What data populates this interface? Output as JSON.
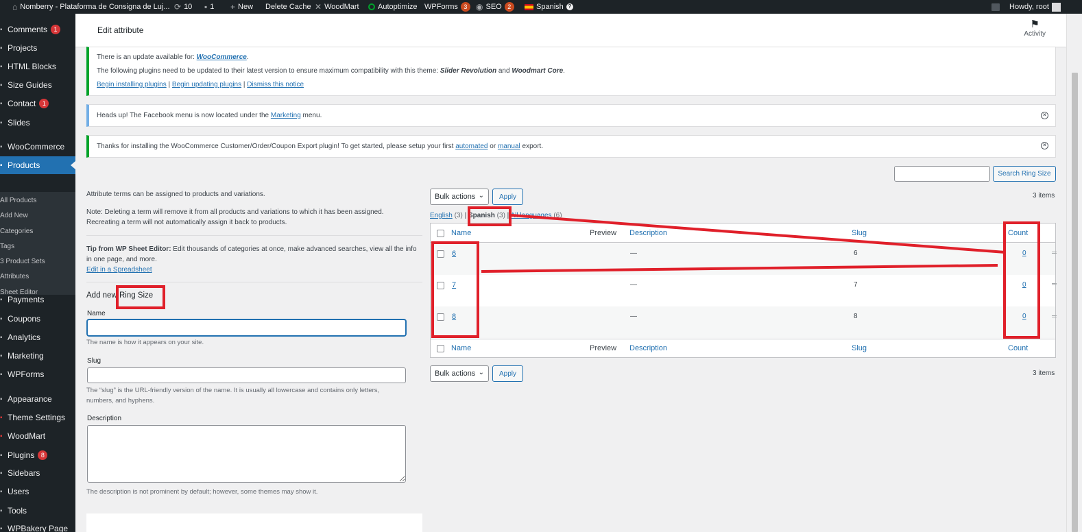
{
  "admin_bar": {
    "site_name": "Nomberry - Plataforma de Consigna de Luj...",
    "updates_count": "10",
    "comments_count": "1",
    "new_label": "New",
    "delete_cache": "Delete Cache",
    "woodmart": "WoodMart",
    "autoptimize": "Autoptimize",
    "wpforms": "WPForms",
    "wpforms_badge": "3",
    "seo": "SEO",
    "seo_badge": "2",
    "language": "Spanish",
    "howdy": "Howdy, root"
  },
  "sidebar": {
    "items": [
      {
        "label": "Comments",
        "badge": "1"
      },
      {
        "label": "Projects"
      },
      {
        "label": "HTML Blocks"
      },
      {
        "label": "Size Guides"
      },
      {
        "label": "Contact",
        "badge": "1"
      },
      {
        "label": "Slides"
      },
      {
        "label": "WooCommerce"
      },
      {
        "label": "Products"
      },
      {
        "label": "Payments"
      },
      {
        "label": "Coupons"
      },
      {
        "label": "Analytics"
      },
      {
        "label": "Marketing"
      },
      {
        "label": "WPForms"
      },
      {
        "label": "Appearance"
      },
      {
        "label": "Theme Settings"
      },
      {
        "label": "WoodMart"
      },
      {
        "label": "Plugins",
        "badge": "8"
      },
      {
        "label": "Sidebars"
      },
      {
        "label": "Users"
      },
      {
        "label": "Tools"
      },
      {
        "label": "WPBakery Page"
      }
    ],
    "submenu": [
      "All Products",
      "Add New",
      "Categories",
      "Tags",
      "3 Product Sets",
      "Attributes",
      "Sheet Editor"
    ]
  },
  "header": {
    "title": "Edit attribute",
    "activity": "Activity"
  },
  "notices": {
    "update_prefix": "There is an update available for: ",
    "update_link": "WooCommerce",
    "update_suffix": ".",
    "plugins_text": "The following plugins need to be updated to their latest version to ensure maximum compatibility with this theme: ",
    "plugin_a": "Slider Revolution",
    "and": " and ",
    "plugin_b": "Woodmart Core",
    "period": ".",
    "begin_installing": "Begin installing plugins",
    "begin_updating": "Begin updating plugins",
    "dismiss_notice": "Dismiss this notice",
    "pipe": "|",
    "facebook_prefix": "Heads up! The Facebook menu is now located under the ",
    "facebook_link": "Marketing",
    "facebook_suffix": " menu.",
    "export_prefix": "Thanks for installing the WooCommerce Customer/Order/Coupon Export plugin! To get started, please setup your first ",
    "export_link_a": "automated",
    "export_or": " or ",
    "export_link_b": "manual",
    "export_suffix": " export."
  },
  "search": {
    "value": "",
    "button": "Search Ring Size"
  },
  "left": {
    "intro": "Attribute terms can be assigned to products and variations.",
    "note_line1": "Note: Deleting a term will remove it from all products and variations to which it has been assigned.",
    "note_line2": "Recreating a term will not automatically assign it back to products.",
    "tip_bold": "Tip from WP Sheet Editor:",
    "tip_line1": " Edit thousands of categories at once, make advanced searches, view all the info",
    "tip_line2": "in one page, and more.",
    "tip_link": "Edit in a Spreadsheet",
    "add_new_prefix": "Add new",
    "add_new_term": "Ring Size",
    "name_label": "Name",
    "name_value": "",
    "name_help": "The name is how it appears on your site.",
    "slug_label": "Slug",
    "slug_value": "",
    "slug_help_1": "The “slug” is the URL-friendly version of the name. It is usually all lowercase and contains only letters,",
    "slug_help_2": "numbers, and hyphens.",
    "desc_label": "Description",
    "desc_value": "",
    "desc_help": "The description is not prominent by default; however, some themes may show it."
  },
  "list": {
    "bulk_actions": "Bulk actions",
    "apply": "Apply",
    "items_count": "3 items",
    "lang_english": "English",
    "lang_english_count": "(3)",
    "lang_spanish": "Spanish",
    "lang_spanish_count": "(3)",
    "lang_all": "All languages",
    "lang_all_count": "(6)",
    "columns": {
      "name": "Name",
      "preview": "Preview",
      "description": "Description",
      "slug": "Slug",
      "count": "Count"
    },
    "rows": [
      {
        "name": "6",
        "description": "—",
        "slug": "6",
        "count": "0"
      },
      {
        "name": "7",
        "description": "—",
        "slug": "7",
        "count": "0"
      },
      {
        "name": "8",
        "description": "—",
        "slug": "8",
        "count": "0"
      }
    ]
  },
  "colors": {
    "accent": "#2271b1",
    "admin_dark": "#1d2327",
    "annotation_red": "#e0202a",
    "notice_green": "#00a32a"
  }
}
